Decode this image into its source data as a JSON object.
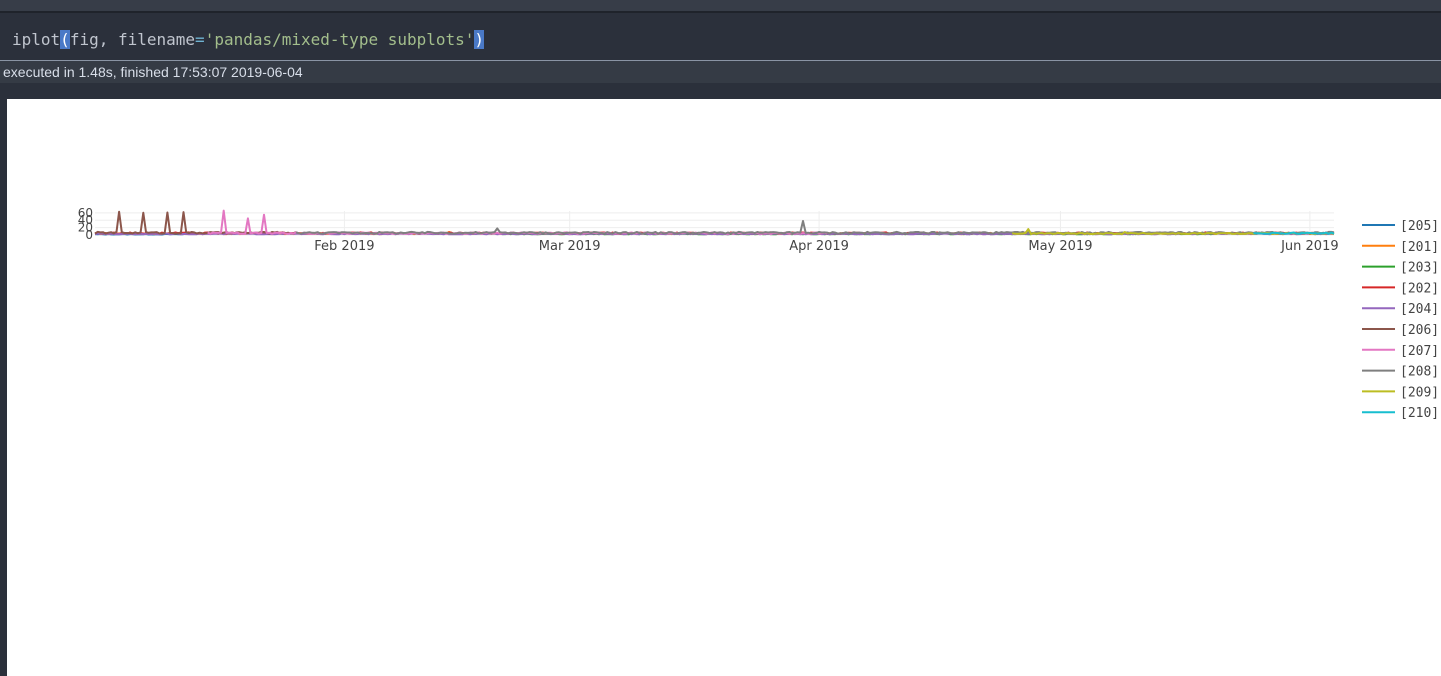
{
  "code_cell": {
    "fn": "iplot",
    "open_paren": "(",
    "arg1": "fig, filename",
    "eq": "=",
    "str": "'pandas/mixed-type subplots'",
    "close_paren": ")"
  },
  "execution": {
    "status": "executed in 1.48s, finished 17:53:07 2019-06-04"
  },
  "chart_data": {
    "type": "line",
    "title": "",
    "xlabel": "",
    "ylabel": "",
    "x_range": [
      "2019-01-01",
      "2019-06-04"
    ],
    "x_ticks": [
      {
        "label": "Feb 2019",
        "date": "2019-02-01"
      },
      {
        "label": "Mar 2019",
        "date": "2019-03-01"
      },
      {
        "label": "Apr 2019",
        "date": "2019-04-01"
      },
      {
        "label": "May 2019",
        "date": "2019-05-01"
      },
      {
        "label": "Jun 2019",
        "date": "2019-06-01"
      }
    ],
    "y_ticks": [
      0,
      20,
      40,
      60
    ],
    "ylim": [
      0,
      65
    ],
    "grid": true,
    "legend_position": "right",
    "series": [
      {
        "name": "[205]",
        "color": "#1f77b4",
        "active": [
          "2019-01-01",
          "2019-01-12"
        ],
        "base": 2,
        "spikes": []
      },
      {
        "name": "[201]",
        "color": "#ff7f0e",
        "active": [
          "2019-01-01",
          "2019-06-04"
        ],
        "base": 4,
        "spikes": [
          {
            "date": "2019-02-14",
            "value": 8
          }
        ]
      },
      {
        "name": "[203]",
        "color": "#2ca02c",
        "active": [
          "2019-02-20",
          "2019-05-20"
        ],
        "base": 3,
        "spikes": []
      },
      {
        "name": "[202]",
        "color": "#d62728",
        "active": [
          "2019-01-01",
          "2019-06-04"
        ],
        "base": 5,
        "spikes": [
          {
            "date": "2019-01-18",
            "value": 7
          }
        ]
      },
      {
        "name": "[204]",
        "color": "#9467bd",
        "active": [
          "2019-01-01",
          "2019-06-04"
        ],
        "base": 3,
        "spikes": []
      },
      {
        "name": "[206]",
        "color": "#8c564b",
        "active": [
          "2019-01-01",
          "2019-01-26"
        ],
        "base": 6,
        "spikes": [
          {
            "date": "2019-01-04",
            "value": 63
          },
          {
            "date": "2019-01-07",
            "value": 60
          },
          {
            "date": "2019-01-10",
            "value": 61
          },
          {
            "date": "2019-01-12",
            "value": 62
          }
        ]
      },
      {
        "name": "[207]",
        "color": "#e377c2",
        "active": [
          "2019-01-15",
          "2019-04-02"
        ],
        "base": 5,
        "spikes": [
          {
            "date": "2019-01-17",
            "value": 66
          },
          {
            "date": "2019-01-20",
            "value": 45
          },
          {
            "date": "2019-01-22",
            "value": 55
          }
        ]
      },
      {
        "name": "[208]",
        "color": "#7f7f7f",
        "active": [
          "2019-01-26",
          "2019-06-04"
        ],
        "base": 6,
        "spikes": [
          {
            "date": "2019-02-20",
            "value": 18
          },
          {
            "date": "2019-03-30",
            "value": 38
          }
        ]
      },
      {
        "name": "[209]",
        "color": "#bcbd22",
        "active": [
          "2019-04-25",
          "2019-06-04"
        ],
        "base": 4,
        "spikes": [
          {
            "date": "2019-04-27",
            "value": 16
          },
          {
            "date": "2019-05-09",
            "value": 8
          }
        ]
      },
      {
        "name": "[210]",
        "color": "#17becf",
        "active": [
          "2019-05-25",
          "2019-06-04"
        ],
        "base": 5,
        "spikes": []
      }
    ]
  }
}
